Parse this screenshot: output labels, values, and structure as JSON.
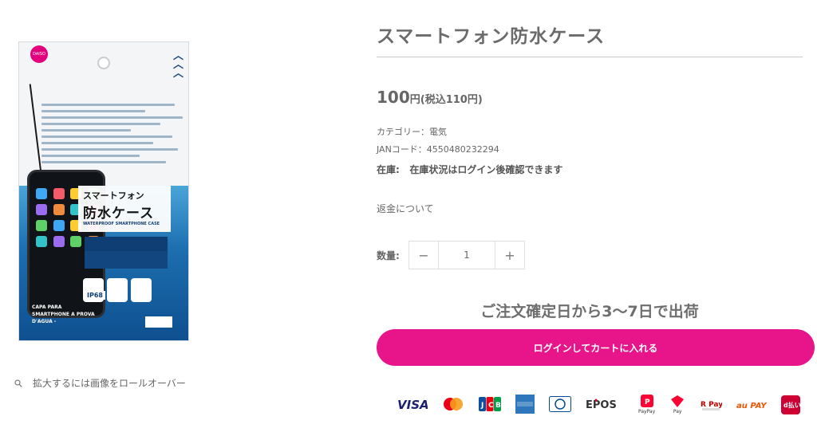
{
  "product": {
    "title": "スマートフォン防水ケース",
    "price_number": "100",
    "price_unit": "円(税込110円)",
    "category": "カテゴリー：電気",
    "jan": "JANコード：4550480232294",
    "stock_label": "在庫:",
    "stock_text": "在庫状況はログイン後確認できます",
    "refund_link": "返金について",
    "quantity_label": "数量:",
    "quantity_value": "1",
    "minus_glyph": "−",
    "plus_glyph": "+",
    "shipping_note": "ご注文確定日から3〜7日で出荷",
    "cart_button": "ログインしてカートに入れる"
  },
  "image": {
    "zoom_hint": "拡大するには画像をロールオーバー",
    "package_text": {
      "brand": "DAISO",
      "line1": "スマートフォン",
      "line2": "防水ケース",
      "line3": "WATERPROOF SMARTPHONE CASE",
      "ip": "IP68",
      "spanish": "CAPA PARA SMARTPHONE A PROVA D'AGUA -"
    }
  },
  "payments": {
    "cards": [
      {
        "name": "VISA",
        "color": "#1a1f71"
      },
      {
        "name": "Mastercard",
        "color": "#eb001b"
      },
      {
        "name": "JCB",
        "color": "#0b4ea2"
      },
      {
        "name": "American Express",
        "color": "#2e77bc"
      },
      {
        "name": "Diners Club",
        "color": "#004a97"
      },
      {
        "name": "EPOS",
        "color": "#c8102e"
      }
    ],
    "qr": [
      {
        "name": "PayPay",
        "color": "#ff0033"
      },
      {
        "name": "Pay",
        "color": "#ff0033"
      },
      {
        "name": "R Pay",
        "color": "#bf0000"
      },
      {
        "name": "au PAY",
        "color": "#eb5505"
      },
      {
        "name": "d払い",
        "color": "#cc0033"
      }
    ]
  }
}
